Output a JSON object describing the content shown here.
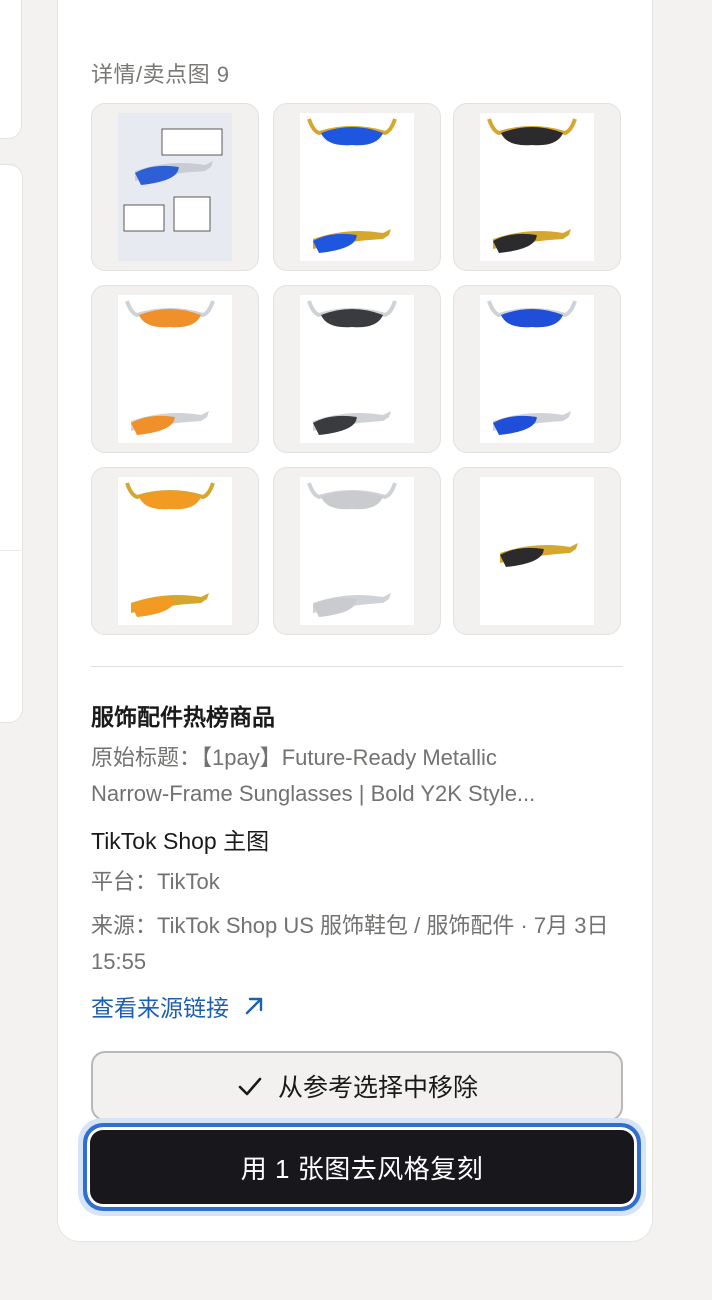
{
  "gallery": {
    "section_label": "详情/卖点图",
    "count": "9",
    "images": [
      {
        "name": "detail-infographic-image",
        "lens_color": "#2f5fd6",
        "frame_color": "#c9ccd2",
        "kind": "infographic"
      },
      {
        "name": "gold-blue-mirror-image",
        "lens_color": "#1f56e0",
        "frame_color": "#d6a72e",
        "kind": "pair"
      },
      {
        "name": "gold-black-lens-image",
        "lens_color": "#2b2b2e",
        "frame_color": "#d6a72e",
        "kind": "pair"
      },
      {
        "name": "silver-orange-mirror-image",
        "lens_color": "#f0902a",
        "frame_color": "#cfd2d6",
        "kind": "pair"
      },
      {
        "name": "silver-black-lens-image",
        "lens_color": "#3a3b3f",
        "frame_color": "#cfd2d6",
        "kind": "pair"
      },
      {
        "name": "silver-blue-mirror-image",
        "lens_color": "#1f4fd8",
        "frame_color": "#cfd2d6",
        "kind": "pair"
      },
      {
        "name": "gold-orange-mirror-image",
        "lens_color": "#f29a22",
        "frame_color": "#d6a72e",
        "kind": "pair"
      },
      {
        "name": "silver-silver-mirror-image",
        "lens_color": "#c9cbcf",
        "frame_color": "#cfd2d6",
        "kind": "pair"
      },
      {
        "name": "gold-black-side-image",
        "lens_color": "#2b2b2e",
        "frame_color": "#d6a72e",
        "kind": "single"
      }
    ]
  },
  "product": {
    "category": "服饰配件热榜商品",
    "original_title_line1": "原始标题：【1pay】Future-Ready Metallic",
    "original_title_line2": "Narrow-Frame Sunglasses | Bold Y2K Style...",
    "main_image_label": "TikTok Shop 主图",
    "platform": "平台：TikTok",
    "source": "来源：TikTok Shop US 服饰鞋包 / 服饰配件 · 7月 3日 15:55",
    "source_link": "查看来源链接"
  },
  "actions": {
    "remove_label": "从参考选择中移除",
    "replicate_label": "用 1 张图去风格复刻"
  },
  "colors": {
    "accent": "#2e6fd0",
    "link": "#1d5fb1",
    "primary_button": "#17171c"
  }
}
